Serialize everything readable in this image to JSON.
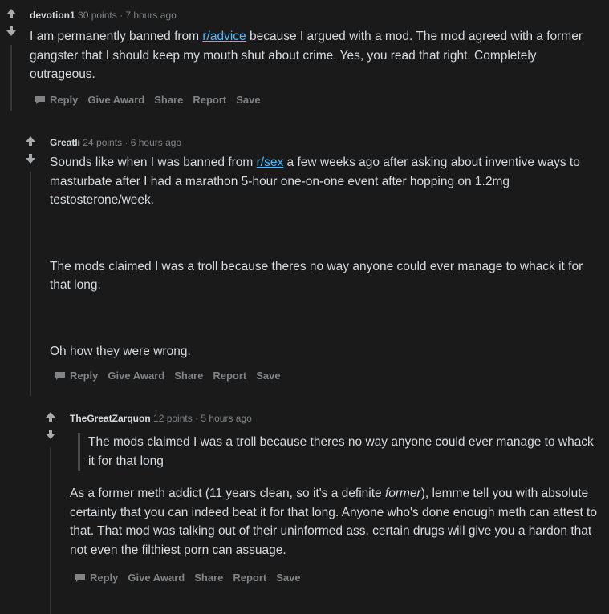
{
  "comments": [
    {
      "author": "devotion1",
      "points": "30 points",
      "sep": "·",
      "time": "7 hours ago",
      "body": [
        {
          "segments": [
            {
              "text": "I am permanently banned from "
            },
            {
              "text": "r/advice",
              "link": true
            },
            {
              "text": " because I argued with a mod. The mod agreed with a former gangster that I should keep my mouth shut about crime. Yes, you read that right. Completely outrageous."
            }
          ]
        }
      ]
    },
    {
      "author": "Greatli",
      "points": "24 points",
      "sep": "·",
      "time": "6 hours ago",
      "body": [
        {
          "segments": [
            {
              "text": "Sounds like when I was banned from "
            },
            {
              "text": "r/sex",
              "link": true
            },
            {
              "text": " a few weeks ago after asking about inventive ways to masturbate after I had a marathon 5-hour one-on-one event after hopping on 1.2mg testosterone/week."
            }
          ]
        },
        {
          "segments": [
            {
              "text": "The mods claimed I was a troll because theres no way anyone could ever manage to whack it for that long."
            }
          ]
        },
        {
          "segments": [
            {
              "text": "Oh how they were wrong."
            }
          ]
        }
      ]
    },
    {
      "author": "TheGreatZarquon",
      "points": "12 points",
      "sep": "·",
      "time": "5 hours ago",
      "quote": "The mods claimed I was a troll because theres no way anyone could ever manage to whack it for that long",
      "body": [
        {
          "segments": [
            {
              "text": "As a former meth addict (11 years clean, so it's a definite "
            },
            {
              "text": "former",
              "italic": true
            },
            {
              "text": "), lemme tell you with absolute certainty that you can indeed beat it for that long. Anyone who's done enough meth can attest to that. That mod was talking out of their uninformed ass, certain drugs will give you a hardon that not even the filthiest porn can assuage."
            }
          ]
        }
      ]
    }
  ],
  "actions": {
    "reply": "Reply",
    "give_award": "Give Award",
    "share": "Share",
    "report": "Report",
    "save": "Save"
  },
  "icons": {
    "upvote": "upvote-arrow-icon",
    "downvote": "downvote-arrow-icon",
    "reply": "comment-bubble-icon"
  },
  "colors": {
    "background": "#1a1a1b",
    "text": "#d7dadc",
    "meta": "#818384",
    "link": "#4fbcff"
  }
}
